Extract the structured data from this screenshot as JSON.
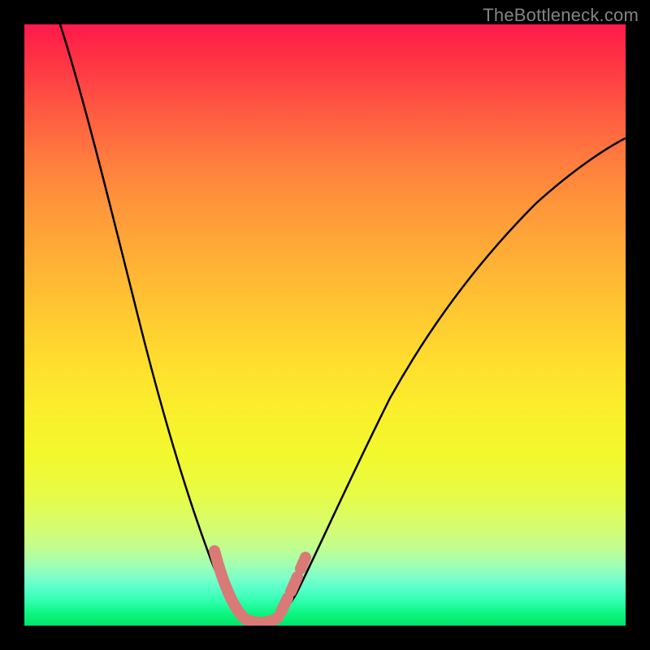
{
  "watermark": "TheBottleneck.com",
  "chart_data": {
    "type": "line",
    "title": "",
    "xlabel": "",
    "ylabel": "",
    "xlim": [
      0,
      100
    ],
    "ylim": [
      0,
      100
    ],
    "grid": false,
    "series": [
      {
        "name": "bottleneck-curve",
        "x": [
          6,
          8,
          10,
          12,
          14,
          16,
          18,
          20,
          22,
          24,
          26,
          28,
          30,
          32,
          34,
          35,
          36,
          37,
          38,
          40,
          42,
          44,
          46,
          48,
          50,
          54,
          58,
          62,
          66,
          70,
          76,
          82,
          88,
          94,
          100
        ],
        "values": [
          100,
          92,
          84,
          76,
          68,
          61,
          54,
          47,
          41,
          35,
          29,
          24,
          19,
          14,
          9,
          6,
          3,
          1,
          0,
          0,
          1,
          3,
          6,
          10,
          14,
          22,
          30,
          37,
          44,
          50,
          58,
          64,
          70,
          75,
          79
        ]
      },
      {
        "name": "highlight-segment",
        "x": [
          32,
          33,
          34,
          35,
          36,
          37,
          38,
          39,
          40,
          41,
          42,
          43
        ],
        "values": [
          12,
          9,
          6,
          3,
          1,
          0,
          0,
          0,
          1,
          2,
          4,
          7
        ]
      }
    ],
    "gradient_stops": [
      {
        "pos": 0,
        "color": "#ff1a4a"
      },
      {
        "pos": 50,
        "color": "#ffc832"
      },
      {
        "pos": 75,
        "color": "#f2f82e"
      },
      {
        "pos": 100,
        "color": "#00e668"
      }
    ],
    "highlight_color": "#d97a77"
  }
}
